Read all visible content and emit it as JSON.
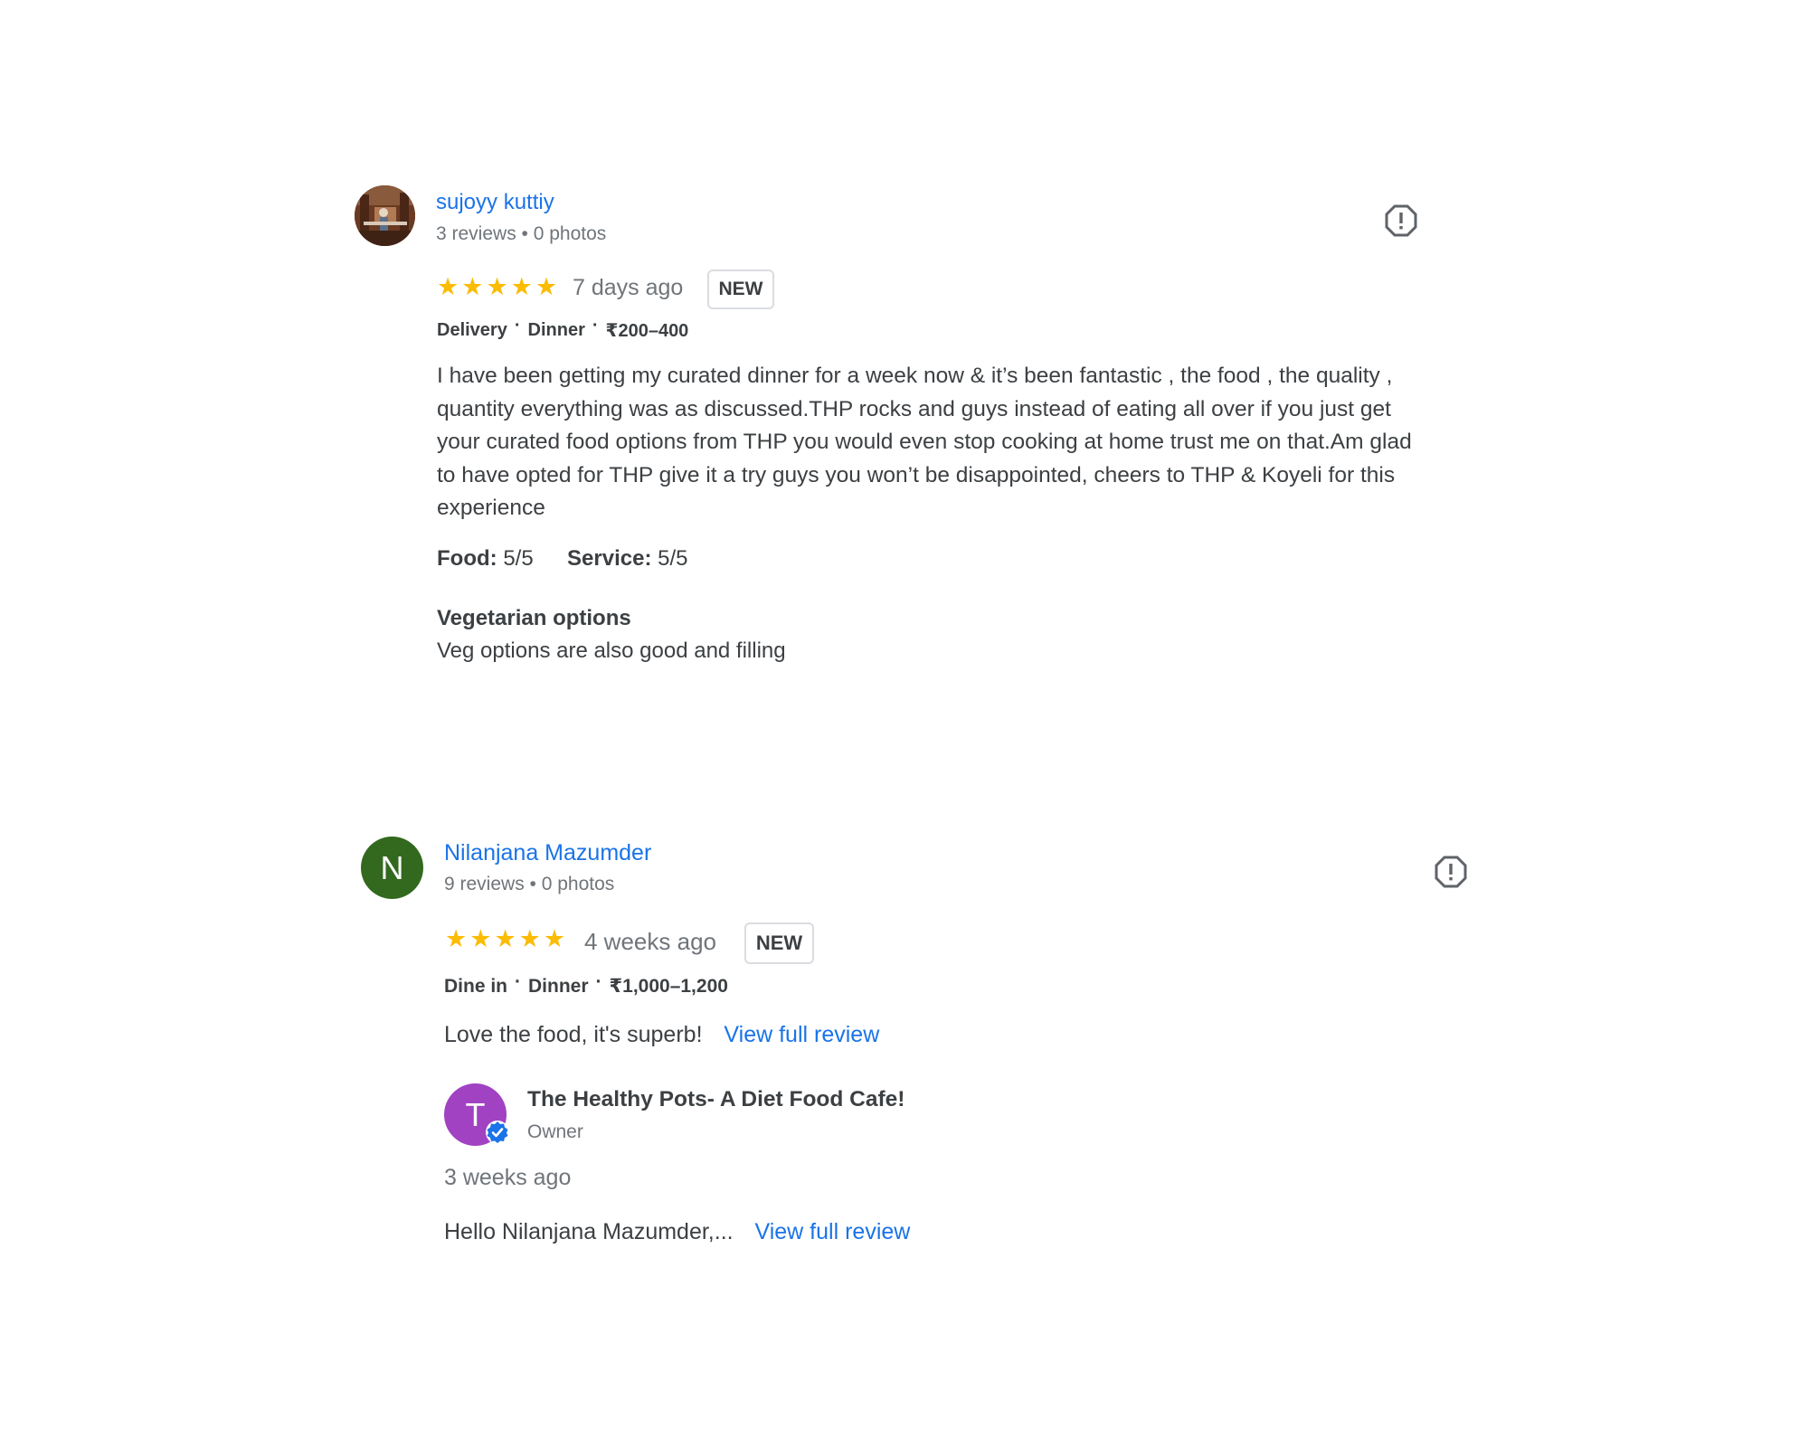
{
  "colors": {
    "link": "#1a73e8",
    "star": "#fbbc04",
    "text": "#3c4043",
    "muted": "#70757a",
    "avatar_n": "#33691e",
    "avatar_t": "#a142c2",
    "verified": "#1a73e8"
  },
  "reviews": [
    {
      "reviewer": {
        "name": "sujoyy kuttiy",
        "meta": "3 reviews • 0 photos",
        "avatar_type": "photo"
      },
      "rating": 5,
      "time": "7 days ago",
      "badge": "NEW",
      "tags": [
        "Delivery",
        "Dinner",
        "₹200–400"
      ],
      "text": "I have been getting my curated dinner for a week now & it’s been fantastic , the food , the quality , quantity everything was as discussed.THP rocks and guys instead of eating all over if you just get your curated food options from THP you would even stop cooking at home trust me on that.Am glad to have opted for THP give it a try guys you won’t be disappointed, cheers to THP & Koyeli for this experience",
      "ratings": {
        "food_label": "Food:",
        "food_value": "5/5",
        "service_label": "Service:",
        "service_value": "5/5"
      },
      "attribute": {
        "title": "Vegetarian options",
        "value": "Veg options are also good and filling"
      },
      "flag_icon": "report-flag-icon"
    },
    {
      "reviewer": {
        "name": "Nilanjana Mazumder",
        "meta": "9 reviews • 0 photos",
        "avatar_letter": "N"
      },
      "rating": 5,
      "time": "4 weeks ago",
      "badge": "NEW",
      "tags": [
        "Dine in",
        "Dinner",
        "₹1,000–1,200"
      ],
      "text": "Love the food, it's superb!",
      "view_full": "View full review",
      "flag_icon": "report-flag-icon",
      "owner_response": {
        "avatar_letter": "T",
        "name": "The Healthy Pots- A Diet Food Cafe!",
        "role": "Owner",
        "time": "3 weeks ago",
        "text": "Hello Nilanjana Mazumder,...",
        "view_full": "View full review"
      }
    }
  ]
}
